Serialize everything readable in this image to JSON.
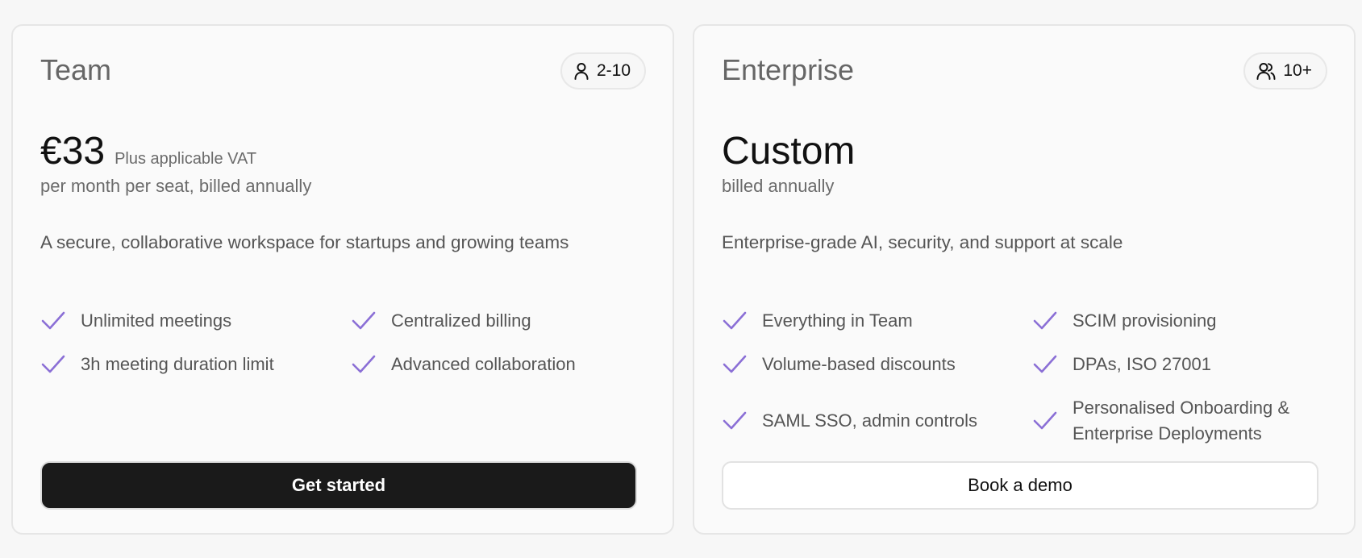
{
  "colors": {
    "accent_check": "#8b6fd6",
    "primary_button_bg": "#1a1a1a",
    "card_bg": "#fafafa",
    "page_bg": "#f7f7f7"
  },
  "plans": [
    {
      "name": "Team",
      "seats": "2-10",
      "seat_icon": "user-icon",
      "price": "€33",
      "price_note": "Plus applicable VAT",
      "billing": "per month per seat, billed annually",
      "description": "A secure, collaborative workspace for startups and growing teams",
      "features": [
        "Unlimited meetings",
        "Centralized billing",
        "3h meeting duration limit",
        "Advanced collaboration"
      ],
      "cta": "Get started"
    },
    {
      "name": "Enterprise",
      "seats": "10+",
      "seat_icon": "users-icon",
      "price": "Custom",
      "price_note": "",
      "billing": "billed annually",
      "description": "Enterprise-grade AI, security, and support at scale",
      "features": [
        "Everything in Team",
        "SCIM provisioning",
        "Volume-based discounts",
        "DPAs, ISO 27001",
        "SAML SSO, admin controls",
        "Personalised Onboarding & Enterprise Deployments"
      ],
      "cta": "Book a demo"
    }
  ]
}
